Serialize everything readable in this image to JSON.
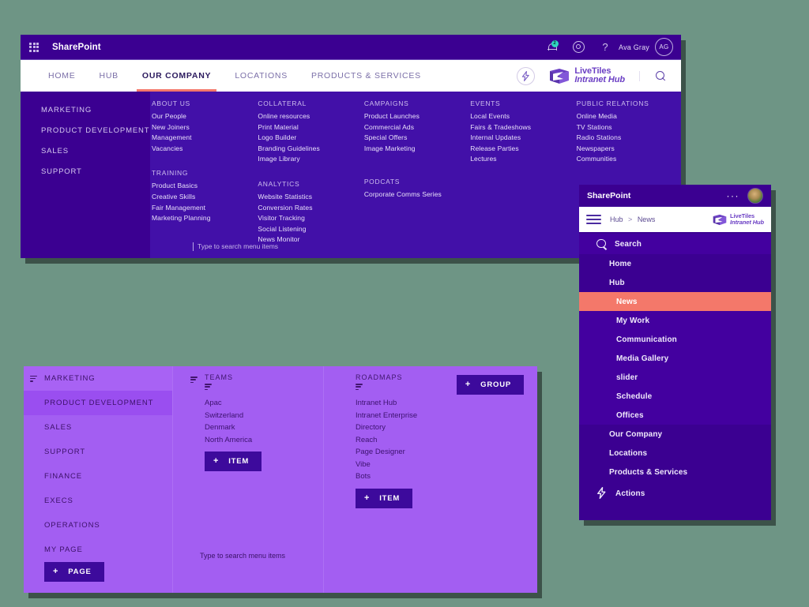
{
  "suite_bar": {
    "app_title": "SharePoint",
    "waffle_icon": "app-launcher-icon",
    "notification_count": "2",
    "help_glyph": "?",
    "user_name": "Ava Gray",
    "avatar_initials": "AG"
  },
  "top_nav": {
    "tabs": [
      {
        "label": "HOME",
        "active": false
      },
      {
        "label": "HUB",
        "active": false
      },
      {
        "label": "OUR COMPANY",
        "active": true
      },
      {
        "label": "LOCATIONS",
        "active": false
      },
      {
        "label": "PRODUCTS & SERVICES",
        "active": false
      }
    ],
    "action_icon": "lightning-bolt-icon",
    "logo_line1": "LiveTiles",
    "logo_line2": "Intranet Hub",
    "search_icon": "search-icon"
  },
  "mega_menu": {
    "left_items": [
      {
        "label": "MARKETING"
      },
      {
        "label": "PRODUCT DEVELOPMENT"
      },
      {
        "label": "SALES"
      },
      {
        "label": "SUPPORT"
      }
    ],
    "columns": [
      {
        "groups": [
          {
            "heading": "ABOUT US",
            "links": [
              "Our People",
              "New Joiners",
              "Management",
              "Vacancies"
            ]
          },
          {
            "heading": "TRAINING",
            "links": [
              "Product Basics",
              "Creative Skills",
              "Fair Management",
              "Marketing Planning"
            ]
          }
        ]
      },
      {
        "groups": [
          {
            "heading": "COLLATERAL",
            "links": [
              "Online resources",
              "Print Material",
              "Logo Builder",
              "Branding Guidelines",
              "Image Library"
            ]
          },
          {
            "heading": "ANALYTICS",
            "links": [
              "Website Statistics",
              "Conversion Rates",
              "Visitor Tracking",
              "Social Listening",
              "News Monitor"
            ]
          }
        ]
      },
      {
        "groups": [
          {
            "heading": "CAMPAIGNS",
            "links": [
              "Product Launches",
              "Commercial Ads",
              "Special Offers",
              "Image Marketing"
            ]
          },
          {
            "heading": "PODCATS",
            "links": [
              "Corporate Comms Series"
            ]
          }
        ]
      },
      {
        "groups": [
          {
            "heading": "EVENTS",
            "links": [
              "Local Events",
              "Fairs & Tradeshows",
              "Internal Updates",
              "Release Parties",
              "Lectures"
            ]
          }
        ]
      },
      {
        "groups": [
          {
            "heading": "PUBLIC RELATIONS",
            "links": [
              "Online Media",
              "TV Stations",
              "Radio Stations",
              "Newspapers",
              "Communities"
            ]
          }
        ]
      }
    ],
    "search_placeholder": "Type to search menu items"
  },
  "mobile_panel": {
    "app_title": "SharePoint",
    "overflow_glyph": "···",
    "avatar_icon": "user-photo-avatar",
    "hamburger_icon": "hamburger-menu-icon",
    "breadcrumb": {
      "root": "Hub",
      "separator": ">",
      "current": "News"
    },
    "logo_line1": "LiveTiles",
    "logo_line2": "Intranet Hub",
    "search_label": "Search",
    "items": [
      {
        "label": "Home",
        "level": 0,
        "active": false
      },
      {
        "label": "Hub",
        "level": 0,
        "active": false
      },
      {
        "label": "News",
        "level": 1,
        "active": true
      },
      {
        "label": "My Work",
        "level": 1,
        "active": false
      },
      {
        "label": "Communication",
        "level": 1,
        "active": false
      },
      {
        "label": "Media Gallery",
        "level": 1,
        "active": false
      },
      {
        "label": "slider",
        "level": 1,
        "active": false
      },
      {
        "label": "Schedule",
        "level": 1,
        "active": false
      },
      {
        "label": "Offices",
        "level": 1,
        "active": false
      },
      {
        "label": "Our Company",
        "level": 0,
        "active": false
      },
      {
        "label": "Locations",
        "level": 0,
        "active": false
      },
      {
        "label": "Products & Services",
        "level": 0,
        "active": false
      }
    ],
    "actions_label": "Actions",
    "actions_icon": "lightning-bolt-icon"
  },
  "editor": {
    "col1": {
      "items": [
        {
          "label": "MARKETING",
          "state": "header"
        },
        {
          "label": "PRODUCT DEVELOPMENT",
          "state": "selected"
        },
        {
          "label": "SALES",
          "state": "normal"
        },
        {
          "label": "SUPPORT",
          "state": "normal"
        },
        {
          "label": "FINANCE",
          "state": "normal"
        },
        {
          "label": "EXECS",
          "state": "normal"
        },
        {
          "label": "OPERATIONS",
          "state": "normal"
        },
        {
          "label": "MY PAGE",
          "state": "normal"
        }
      ],
      "add_button": {
        "plus": "+",
        "label": "PAGE"
      }
    },
    "col2": {
      "heading": "TEAMS",
      "links": [
        "Apac",
        "Switzerland",
        "Denmark",
        "North America"
      ],
      "add_button": {
        "plus": "+",
        "label": "ITEM"
      },
      "search_placeholder": "Type to search menu items"
    },
    "col3": {
      "heading": "ROADMAPS",
      "links": [
        "Intranet Hub",
        "Intranet Enterprise",
        "Directory",
        "Reach",
        "Page Designer",
        "Vibe",
        "Bots"
      ],
      "add_button": {
        "plus": "+",
        "label": "ITEM"
      },
      "group_button": {
        "plus": "+",
        "label": "GROUP"
      }
    }
  },
  "colors": {
    "suite_purple": "#3b0091",
    "mega_bg": "#4210a8",
    "accent_orange": "#f4786a",
    "editor_purple": "#a35ef2",
    "button_purple": "#3d0a9c",
    "badge_teal": "#2fd6c0",
    "canvas_green": "#6e9585"
  }
}
